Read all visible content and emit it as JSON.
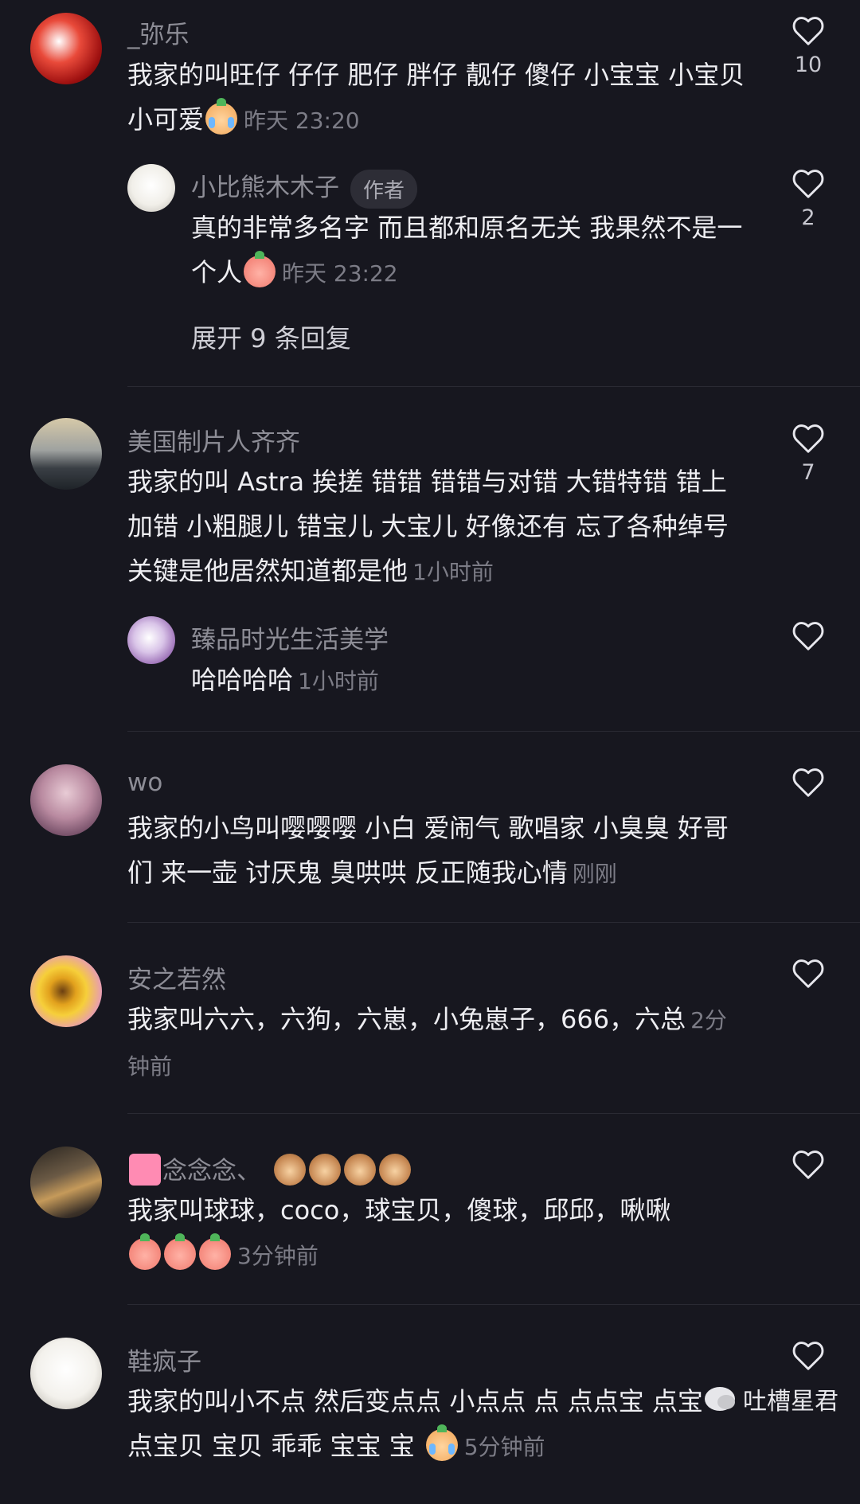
{
  "comments": [
    {
      "user": "_弥乐",
      "text": "我家的叫旺仔 仔仔 肥仔 胖仔 靓仔 傻仔 小宝宝 小宝贝 小可爱",
      "time": "昨天 23:20",
      "likes": "10",
      "replies": [
        {
          "user": "小比熊木木子",
          "tag": "作者",
          "text": "真的非常多名字 而且都和原名无关 我果然不是一个人",
          "time": "昨天 23:22",
          "likes": "2"
        }
      ],
      "expand_label": "展开 9 条回复"
    },
    {
      "user": "美国制片人齐齐",
      "text": "我家的叫 Astra 挨搓 错错 错错与对错 大错特错 错上加错 小粗腿儿 错宝儿 大宝儿 好像还有 忘了各种绰号 关键是他居然知道都是他",
      "time": "1小时前",
      "likes": "7",
      "replies": [
        {
          "user": "臻品时光生活美学",
          "text": "哈哈哈哈",
          "time": "1小时前",
          "likes": ""
        }
      ]
    },
    {
      "user": "wo",
      "text": "我家的小鸟叫嘤嘤嘤 小白 爱闹气 歌唱家 小臭臭 好哥们 来一壶 讨厌鬼 臭哄哄 反正随我心情",
      "time": "刚刚",
      "likes": ""
    },
    {
      "user": "安之若然",
      "text": "我家叫六六，六狗，六崽，小兔崽子，666，六总",
      "time": "2分钟前",
      "likes": ""
    },
    {
      "user": "念念念、",
      "text": "我家叫球球，coco，球宝贝，傻球，邱邱，啾啾",
      "time": "3分钟前",
      "likes": ""
    },
    {
      "user": "鞋疯子",
      "text": "我家的叫小不点 然后变点点  小点点  点  点点宝 点宝 点宝贝  宝贝 乖乖  宝宝 宝",
      "time": "5分钟前",
      "likes": ""
    }
  ],
  "watermark": "吐槽星君",
  "colors": {
    "background": "#17171f",
    "name": "#8d8d96",
    "text": "#eeeef2",
    "time": "#7c7c86"
  }
}
